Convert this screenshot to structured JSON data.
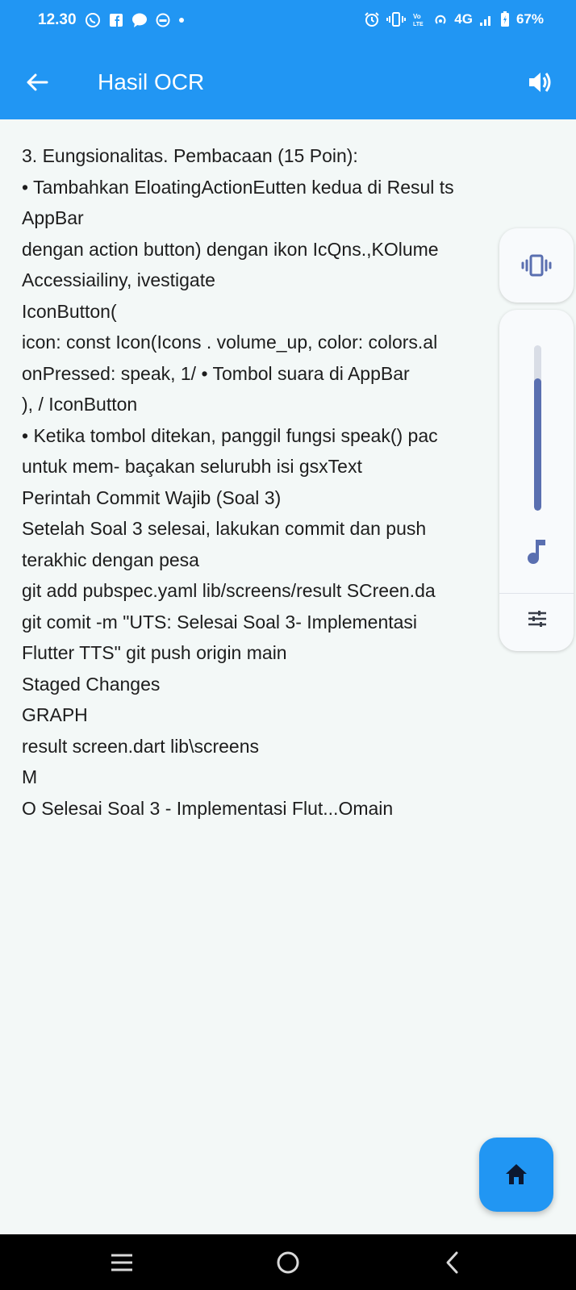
{
  "status_bar": {
    "time": "12.30",
    "network": "4G",
    "battery": "67%",
    "icons": [
      "whatsapp-icon",
      "facebook-icon",
      "chat-bubble-icon",
      "sync-icon",
      "dot-icon",
      "alarm-icon",
      "vibrate-icon",
      "volte-icon",
      "hotspot-icon",
      "signal-icon",
      "battery-icon"
    ]
  },
  "app_bar": {
    "title": "Hasil OCR",
    "back_icon": "arrow-back-icon",
    "action_icon": "volume-up-icon"
  },
  "ocr_text": {
    "lines": [
      "3. Eungsionalitas. Pembacaan (15 Poin):",
      "• Tambahkan EloatingActionEutten kedua di Resul ts",
      "AppBar",
      "dengan action button) dengan ikon IcQns.,KOlume",
      "Accessiailiny, ivestigate",
      "IconButton(",
      "icon: const Icon(Icons . volume_up, color: colors.al",
      "onPressed: speak, 1/ • Tombol suara di AppBar",
      "), / IconButton",
      "• Ketika tombol ditekan, panggil fungsi speak() pac",
      "untuk mem- baçakan selurubh isi gsxText",
      "Perintah Commit Wajib (Soal 3)",
      "Setelah Soal 3 selesai, lakukan commit dan push",
      "terakhic dengan pesa",
      "git add pubspec.yaml lib/screens/result SCreen.da",
      "git comit -m \"UTS: Selesai Soal 3- Implementasi",
      "Flutter TTS\" git push origin main",
      "Staged Changes",
      "GRAPH",
      "result screen.dart lib\\screens",
      "M",
      "O Selesai Soal 3 - Implementasi Flut...Omain"
    ]
  },
  "volume_panel": {
    "vibrate_icon": "vibrate-icon",
    "level": 0.8,
    "stream_icon": "music-note-icon",
    "settings_icon": "equalizer-icon"
  },
  "fab": {
    "icon": "home-icon"
  },
  "nav_bar": {
    "icons": [
      "recent-apps-icon",
      "home-circle-icon",
      "back-chevron-icon"
    ]
  },
  "colors": {
    "primary": "#2196f3",
    "slider": "#5a6fb0",
    "background": "#f3f8f7"
  }
}
